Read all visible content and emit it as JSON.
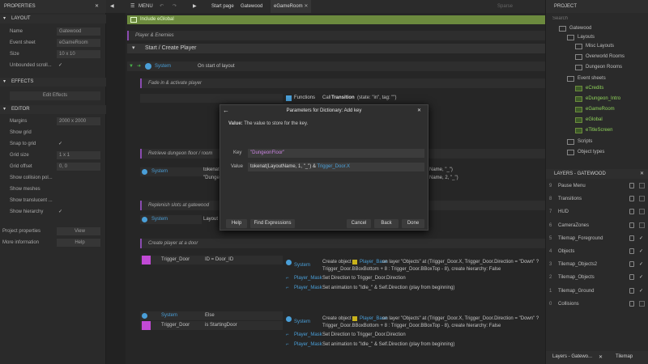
{
  "left": {
    "title": "PROPERTIES",
    "layout_header": "LAYOUT",
    "layout_rows": [
      {
        "key": "Name",
        "value": "Gatewood"
      },
      {
        "key": "Event sheet",
        "value": "eGameRoom"
      },
      {
        "key": "Size",
        "value": "10 x 10"
      },
      {
        "key": "Unbounded scroll...",
        "value": "✓"
      }
    ],
    "effects_header": "EFFECTS",
    "edit_effects": "Edit Effects",
    "editor_header": "EDITOR",
    "editor_rows": [
      {
        "key": "Margins",
        "value": "2000 x 2000"
      },
      {
        "key": "Show grid",
        "value": ""
      },
      {
        "key": "Snap to grid",
        "value": "✓"
      },
      {
        "key": "Grid size",
        "value": "1 x 1"
      },
      {
        "key": "Grid offset",
        "value": "0, 0"
      },
      {
        "key": "Show collision pol...",
        "value": ""
      },
      {
        "key": "Show meshes",
        "value": ""
      },
      {
        "key": "Show translucent ...",
        "value": ""
      },
      {
        "key": "Show hierarchy",
        "value": "✓"
      }
    ],
    "project_props": {
      "key": "Project properties",
      "value": "View"
    },
    "more_info": {
      "key": "More information",
      "value": "Help"
    }
  },
  "topbar": {
    "menu": "MENU",
    "start_page": "Start page",
    "gatewood": "Gatewood",
    "egameroom": "eGameRoom",
    "sparse": "Sparse"
  },
  "sheet": {
    "include": "Include eGlobal",
    "comment_player": "Player & Enemies",
    "group_title": "Start / Create Player",
    "event1": {
      "object": "System",
      "condition": "On start of layout"
    },
    "comment_fade": "Fade in & activate player",
    "functions_label": "Functions",
    "call_transition": "Call",
    "call_bold": "Transition",
    "call_args": "(state: \"in\", tag: \"\")",
    "comment_retrieve": "Retrieve dungeon floor / room",
    "event2": {
      "object": "System",
      "line1": "tokenat",
      "line2": "\"Dungeo",
      "right1": "Name, \"_\")",
      "right2": "Name, 2, \"_\")"
    },
    "comment_replenish": "Replenish slots at gatewood",
    "event3": {
      "object": "System",
      "line1": "Layout"
    },
    "comment_create": "Create player at a door",
    "event4": {
      "cond_object": "Trigger_Door",
      "cond_text": "ID = Door_ID",
      "act_object": "System",
      "act_line1a": "Create object",
      "act_line1b": "Player_Base",
      "act_line1c": "on layer \"Objects\" at (Trigger_Door.X, Trigger_Door.Direction = \"Down\" ?",
      "act_line2": "Trigger_Door.BBoxBottom + 8 : Trigger_Door.BBoxTop - 8), create hierarchy: False",
      "mask1": "Player_Mask",
      "mask1_text": "Set Direction to Trigger_Door.Direction",
      "mask2": "Player_Mask",
      "mask2_text": "Set animation to \"Idle_\" & Self.Direction (play from beginning)"
    },
    "event5": {
      "cond1_object": "System",
      "cond1_text": "Else",
      "cond2_object": "Trigger_Door",
      "cond2_text": "is StartingDoor",
      "act_object": "System",
      "act_line1a": "Create object",
      "act_line1b": "Player_Base",
      "act_line1c": "on layer \"Objects\" at (Trigger_Door.X, Trigger_Door.Direction = \"Down\" ?",
      "act_line2": "Trigger_Door.BBoxBottom + 8 : Trigger_Door.BBoxTop - 8), create hierarchy: False",
      "mask1": "Player_Mask",
      "mask1_text": "Set Direction to Trigger_Door.Direction",
      "mask2": "Player_Mask",
      "mask2_text": "Set animation to \"Idle_\" & Self.Direction (play from beginning)"
    }
  },
  "dialog": {
    "title": "Parameters for Dictionary: Add key",
    "desc_bold": "Value:",
    "desc": "The value to store for the key.",
    "key_label": "Key",
    "key_value": "\"DungeonFloor\"",
    "value_label": "Value",
    "value_text_a": "tokenat(LayoutName, 1, \"_\") & ",
    "value_text_b": "Trigger_Door.X",
    "help": "Help",
    "find": "Find Expressions",
    "cancel": "Cancel",
    "back": "Back",
    "done": "Done"
  },
  "right": {
    "title": "PROJECT",
    "search_placeholder": "Search",
    "tree": [
      {
        "label": "Gatewood",
        "indent": 0
      },
      {
        "label": "Layouts",
        "indent": 1
      },
      {
        "label": "Misc Layouts",
        "indent": 2
      },
      {
        "label": "Overworld Rooms",
        "indent": 2
      },
      {
        "label": "Dungeon Rooms",
        "indent": 2
      },
      {
        "label": "Event sheets",
        "indent": 1
      },
      {
        "label": "eCredits",
        "indent": 2
      },
      {
        "label": "eDungeon_Intro",
        "indent": 2
      },
      {
        "label": "eGameRoom",
        "indent": 2
      },
      {
        "label": "eGlobal",
        "indent": 2
      },
      {
        "label": "eTitleScreen",
        "indent": 2
      },
      {
        "label": "Scripts",
        "indent": 1
      },
      {
        "label": "Object types",
        "indent": 1
      }
    ],
    "layers_title": "LAYERS - GATEWOOD",
    "layers": [
      {
        "n": "9",
        "name": "Pause Menu",
        "checked": false
      },
      {
        "n": "8",
        "name": "Transitions",
        "checked": false
      },
      {
        "n": "7",
        "name": "HUD",
        "checked": false
      },
      {
        "n": "6",
        "name": "CameraZones",
        "checked": false
      },
      {
        "n": "5",
        "name": "Tilemap_Foreground",
        "checked": true
      },
      {
        "n": "4",
        "name": "Objects",
        "checked": true
      },
      {
        "n": "3",
        "name": "Tilemap_Objects2",
        "checked": true
      },
      {
        "n": "2",
        "name": "Tilemap_Objects",
        "checked": true
      },
      {
        "n": "1",
        "name": "Tilemap_Ground",
        "checked": true
      },
      {
        "n": "0",
        "name": "Collisions",
        "checked": false
      }
    ],
    "bottom_tab1": "Layers - Gatewo...",
    "bottom_tab2": "Tilemap"
  },
  "colors": {
    "accent_blue": "#4a9fd8",
    "include_green": "#6c8a3e",
    "pink": "#c14ad5",
    "comment": "#8a4bb0"
  }
}
